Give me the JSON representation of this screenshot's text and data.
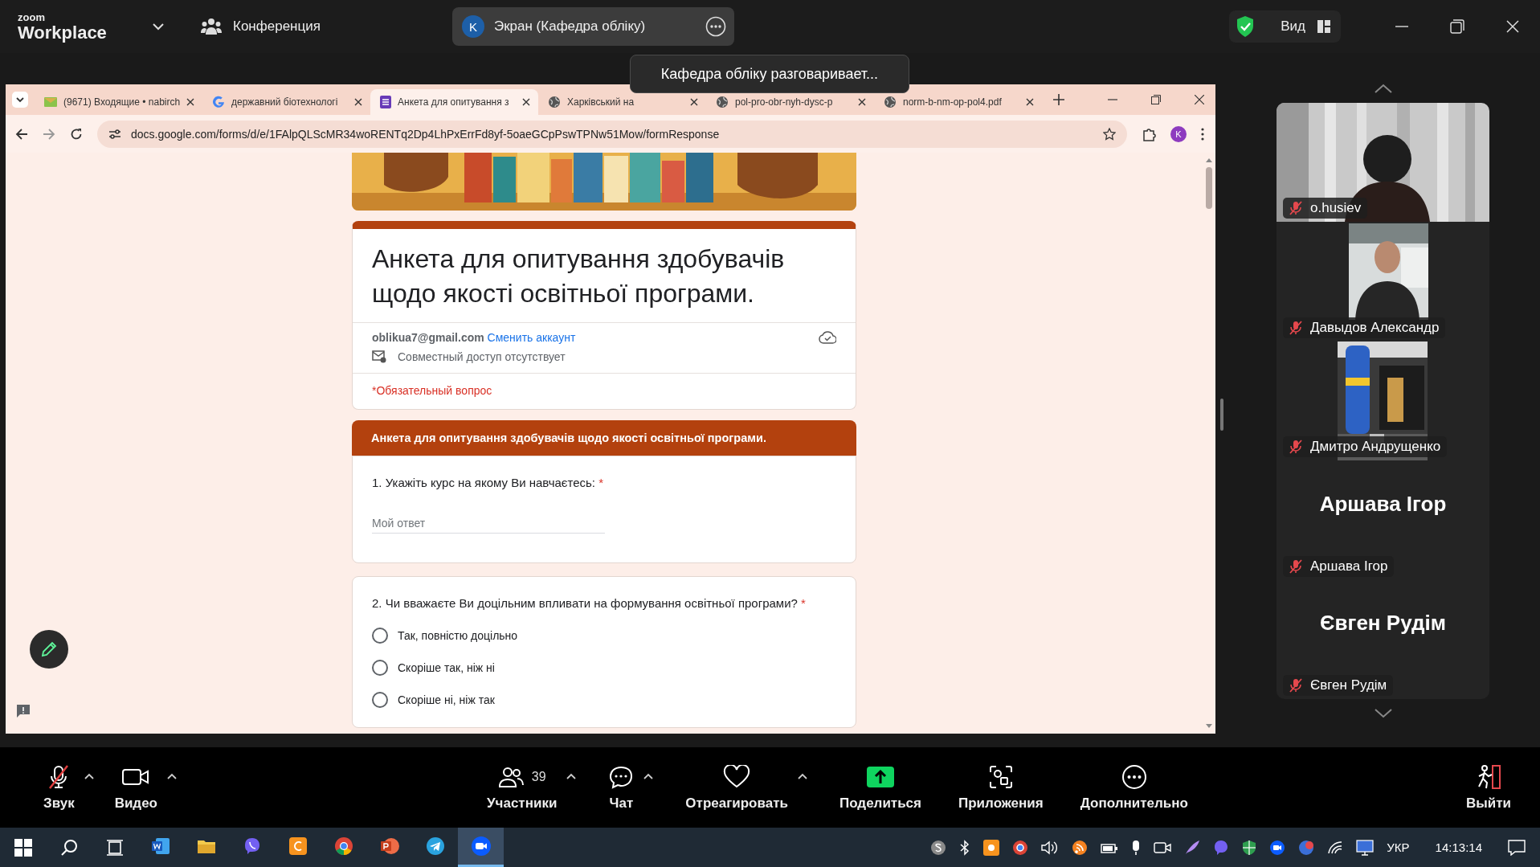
{
  "zoom_bar": {
    "brand_small": "zoom",
    "brand": "Workplace",
    "meeting": "Конференция",
    "share": {
      "avatar": "K",
      "title": "Экран (Кафедра обліку)"
    },
    "view": "Вид"
  },
  "toast": "Кафедра обліку разговаривает...",
  "browser": {
    "tabs": [
      {
        "kind": "mail",
        "title": "(9671) Входящие • nabirch",
        "selected": false
      },
      {
        "kind": "google",
        "title": "державний біотехнологі",
        "selected": false
      },
      {
        "kind": "forms",
        "title": "Анкета для опитування з",
        "selected": true
      },
      {
        "kind": "web",
        "title": "Харківський на",
        "selected": false
      },
      {
        "kind": "web",
        "title": "pol-pro-obr-nyh-dysc-p",
        "selected": false
      },
      {
        "kind": "web",
        "title": "norm-b-nm-op-pol4.pdf",
        "selected": false
      }
    ],
    "avatar": "K",
    "url": "docs.google.com/forms/d/e/1FAlpQLScMR34woRENTq2Dp4LhPxErrFd8yf-5oaeGCpPswTPNw51Mow/formResponse"
  },
  "form": {
    "title": "Анкета для опитування здобувачів щодо якості освітньої програми.",
    "email": "oblikua7@gmail.com",
    "switch_account": "Сменить аккаунт",
    "sharing": "Совместный доступ отсутствует",
    "required_note": "*Обязательный вопрос",
    "section": "Анкета для опитування здобувачів щодо якості освітньої програми.",
    "questions": [
      {
        "kind": "text",
        "title": "1. Укажіть курс на якому Ви навчаєтесь:",
        "mark": "*",
        "placeholder": "Мой ответ"
      },
      {
        "kind": "choice",
        "title": "2. Чи вважаєте Ви доцільним впливати на формування освітньої програми?",
        "mark": "*",
        "options": [
          {
            "label": "Так, повністю доцільно",
            "selected": false
          },
          {
            "label": "Скоріше так, ніж ні",
            "selected": false
          },
          {
            "label": "Скоріше ні, ніж так",
            "selected": false
          }
        ]
      }
    ]
  },
  "participants": [
    {
      "kind": "video",
      "name": "o.husiev",
      "muted": true
    },
    {
      "kind": "video",
      "name": "Давыдов Александр",
      "muted": true
    },
    {
      "kind": "video",
      "name": "Дмитро Андрущенко",
      "muted": true
    },
    {
      "kind": "name",
      "display": "Аршава Ігор",
      "name": "Аршава Ігор",
      "muted": true
    },
    {
      "kind": "name",
      "display": "Євген Рудім",
      "name": "Євген Рудім",
      "muted": true
    }
  ],
  "toolbar": [
    {
      "kind": "audio",
      "label": "Звук",
      "muted": true,
      "menu": true
    },
    {
      "kind": "video",
      "label": "Видео",
      "menu": true
    },
    {
      "kind": "participants",
      "label": "Участники",
      "count": "39",
      "menu": true
    },
    {
      "kind": "chat",
      "label": "Чат",
      "menu": true
    },
    {
      "kind": "react",
      "label": "Отреагировать",
      "menu": true
    },
    {
      "kind": "share",
      "label": "Поделиться"
    },
    {
      "kind": "apps",
      "label": "Приложения"
    },
    {
      "kind": "more",
      "label": "Дополнительно"
    },
    {
      "kind": "leave",
      "label": "Выйти"
    }
  ],
  "taskbar": {
    "apps": [
      {
        "kind": "word",
        "selected": false
      },
      {
        "kind": "folder",
        "selected": false
      },
      {
        "kind": "viber",
        "selected": false
      },
      {
        "kind": "orange",
        "selected": false
      },
      {
        "kind": "chrome",
        "selected": false
      },
      {
        "kind": "powerpoint",
        "selected": false
      },
      {
        "kind": "telegram",
        "selected": false
      },
      {
        "kind": "zoom",
        "selected": true
      }
    ],
    "language": "УКР",
    "clock": "14:13:14"
  }
}
